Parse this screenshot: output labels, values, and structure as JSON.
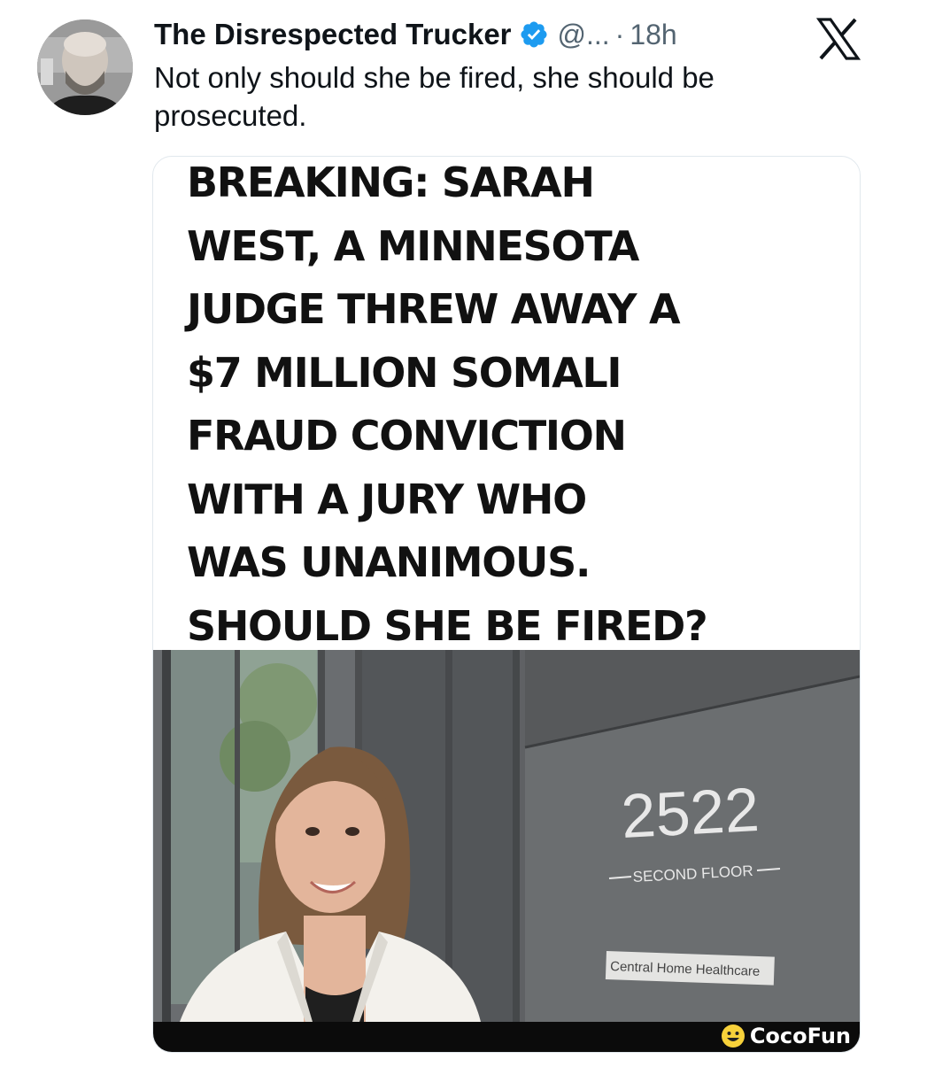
{
  "post": {
    "author_name": "The Disrespected Trucker",
    "handle": "@...",
    "separator": "·",
    "time": "18h",
    "text": "Not only should she be fired, she should be prosecuted."
  },
  "card": {
    "headline_lines": [
      "BREAKING: SARAH",
      "WEST, A MINNESOTA",
      "JUDGE THREW AWAY A",
      "$7 MILLION SOMALI",
      "FRAUD CONVICTION",
      "WITH A JURY WHO",
      "WAS UNANIMOUS.",
      "SHOULD SHE BE FIRED?"
    ],
    "building_number": "2522",
    "floor_sign": "SECOND FLOOR",
    "business_sign": "Central Home Healthcare",
    "watermark": "CocoFun"
  },
  "icons": {
    "verified": "verified-badge-icon",
    "platform": "x-logo-icon",
    "watermark": "cocofun-smiley-icon"
  },
  "colors": {
    "verified_blue": "#1d9bf0",
    "secondary_text": "#536471",
    "watermark_yellow": "#f7d13a"
  }
}
